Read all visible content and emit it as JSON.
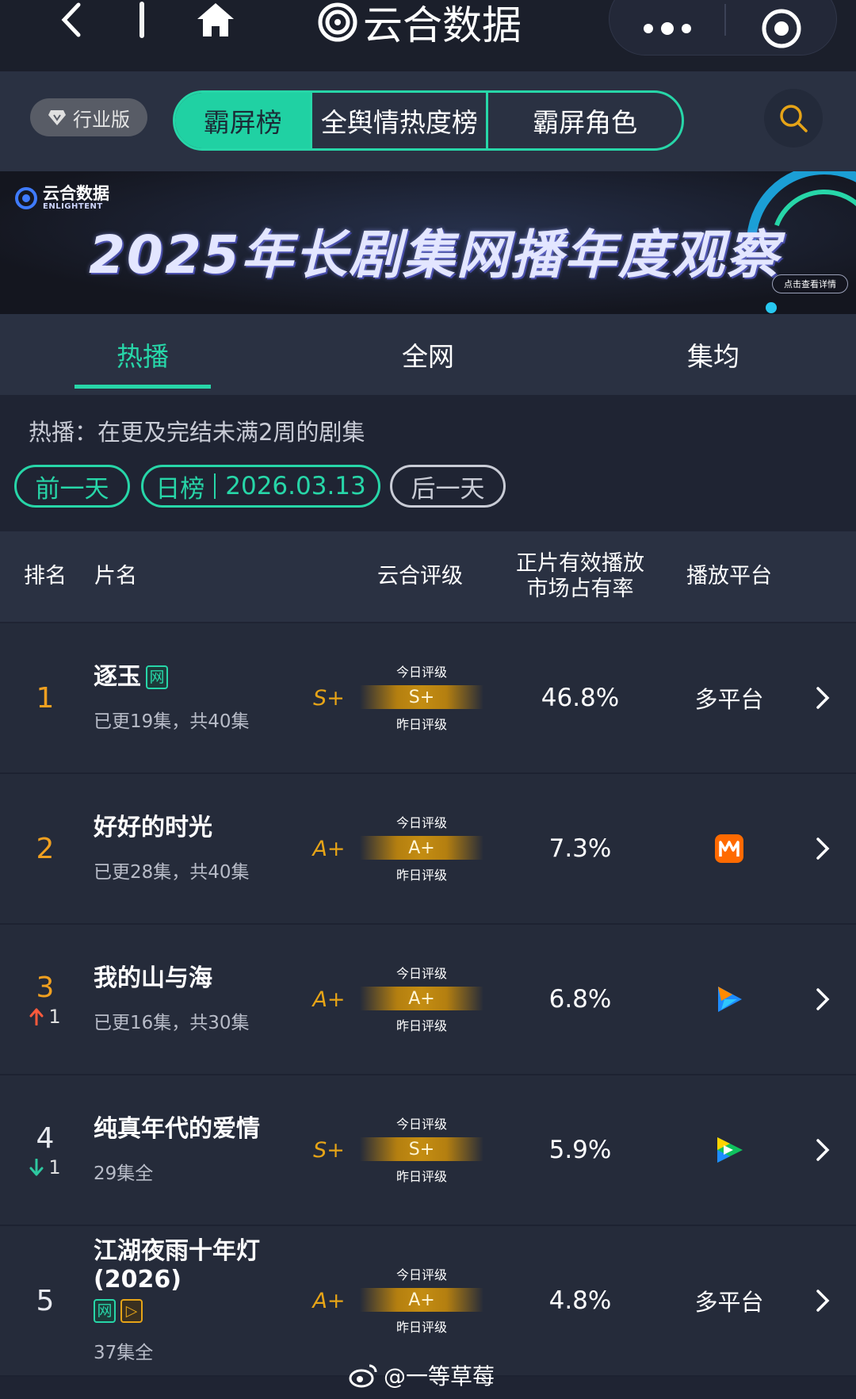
{
  "app": {
    "title": "云合数据"
  },
  "category": {
    "industry_label": "行业版",
    "segments": [
      "霸屏榜",
      "全舆情热度榜",
      "霸屏角色"
    ]
  },
  "banner": {
    "logo_text": "云合数据",
    "logo_sub": "ENLIGHTENT",
    "title": "2025年长剧集网播年度观察",
    "detail_label": "点击查看详情"
  },
  "tabs": [
    "热播",
    "全网",
    "集均"
  ],
  "description": "热播：在更及完结未满2周的剧集",
  "date_nav": {
    "prev": "前一天",
    "board": "日榜",
    "date": "2026.03.13",
    "next": "后一天"
  },
  "table": {
    "headers": {
      "rank": "排名",
      "name": "片名",
      "rating": "云合评级",
      "share": "正片有效播放\n市场占有率",
      "platform": "播放平台"
    },
    "today_label": "今日评级",
    "yesterday_label": "昨日评级",
    "rows": [
      {
        "rank": "1",
        "name": "逐玉",
        "badges": [
          "网"
        ],
        "episodes": "已更19集，共40集",
        "grade": "S+",
        "today_grade": "S+",
        "share": "46.8%",
        "platform": "多平台",
        "platform_icon": ""
      },
      {
        "rank": "2",
        "name": "好好的时光",
        "badges": [],
        "episodes": "已更28集，共40集",
        "grade": "A+",
        "today_grade": "A+",
        "share": "7.3%",
        "platform": "",
        "platform_icon": "mango-tv-icon"
      },
      {
        "rank": "3",
        "trend": "up",
        "trend_value": "1",
        "name": "我的山与海",
        "badges": [],
        "episodes": "已更16集，共30集",
        "grade": "A+",
        "today_grade": "A+",
        "share": "6.8%",
        "platform": "",
        "platform_icon": "tencent-video-icon"
      },
      {
        "rank": "4",
        "trend": "down",
        "trend_value": "1",
        "name": "纯真年代的爱情",
        "badges": [],
        "episodes": "29集全",
        "grade": "S+",
        "today_grade": "S+",
        "share": "5.9%",
        "platform": "",
        "platform_icon": "iqiyi-icon"
      },
      {
        "rank": "5",
        "name": "江湖夜雨十年灯(2026)",
        "badges": [
          "网",
          "▷"
        ],
        "episodes": "37集全",
        "grade": "A+",
        "today_grade": "A+",
        "share": "4.8%",
        "platform": "多平台",
        "platform_icon": ""
      }
    ]
  },
  "watermark": "@一等草莓",
  "colors": {
    "accent": "#27d6a8",
    "gold": "#e6a417",
    "rank_orange": "#f0a020",
    "up": "#ff5a3c",
    "down": "#2ec8a0"
  }
}
